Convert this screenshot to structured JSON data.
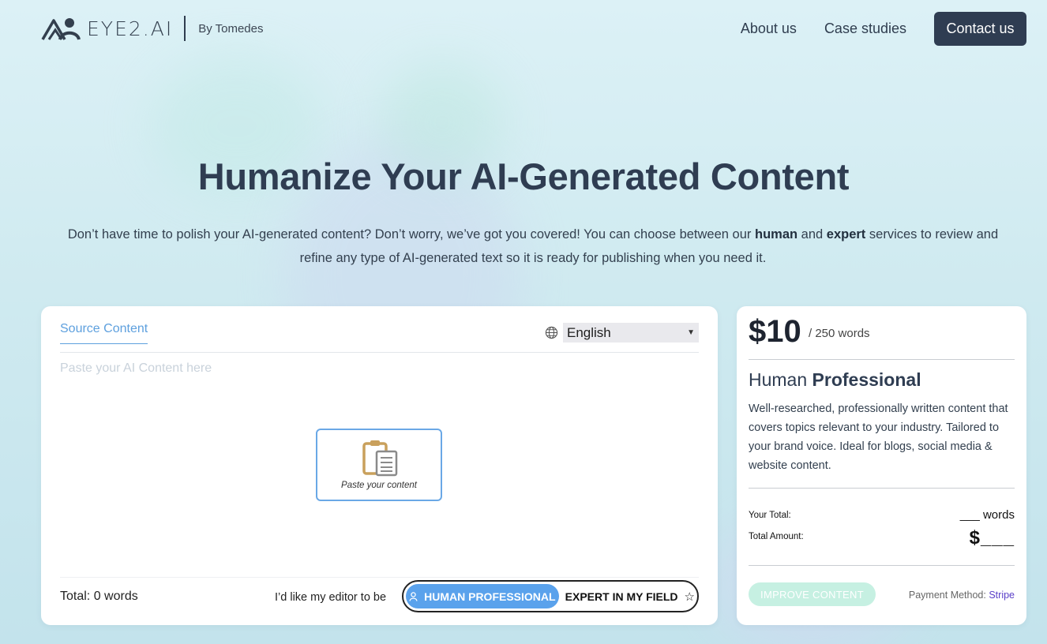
{
  "header": {
    "logo_text": "EYE2.AI",
    "byline": "By Tomedes",
    "nav": [
      {
        "label": "About us"
      },
      {
        "label": "Case studies"
      }
    ],
    "contact_label": "Contact us"
  },
  "hero": {
    "title": "Humanize Your AI-Generated Content",
    "desc_part1": "Don’t have time to polish your AI-generated content? Don’t worry, we’ve got you covered! You can choose between our ",
    "desc_bold1": "human",
    "desc_part2": " and ",
    "desc_bold2": "expert",
    "desc_part3": " services to review and refine any type of AI-generated text so it is ready for publishing when you need it."
  },
  "editor": {
    "tab_label": "Source Content",
    "language": "English",
    "placeholder": "Paste your AI Content here",
    "paste_label": "Paste your content",
    "total_label": "Total: 0 words",
    "preference_label": "I’d like my editor to be",
    "options": {
      "human": "HUMAN PROFESSIONAL",
      "expert": "EXPERT IN MY FIELD",
      "selected": "human"
    }
  },
  "pricing": {
    "price": "$10",
    "per": "/ 250 words",
    "title_regular": "Human ",
    "title_bold": "Professional",
    "description": "Well-researched, professionally written content that covers topics relevant to your industry. Tailored to your brand voice. Ideal for blogs, social media & website content.",
    "your_total_label": "Your Total:",
    "words_value": "___ words",
    "total_amount_label": "Total Amount:",
    "amount_value": "$___",
    "improve_label": "IMPROVE CONTENT",
    "payment_label": "Payment Method: ",
    "payment_method": "Stripe"
  },
  "colors": {
    "accent_blue": "#5aa2ec",
    "dark_navy": "#2f3d52",
    "improve_disabled": "#c6f0e2",
    "stripe_purple": "#5a3fc8"
  },
  "icons": [
    "logo-mark-icon",
    "globe-icon",
    "clipboard-icon",
    "user-icon",
    "star-icon",
    "caret-down-icon"
  ]
}
